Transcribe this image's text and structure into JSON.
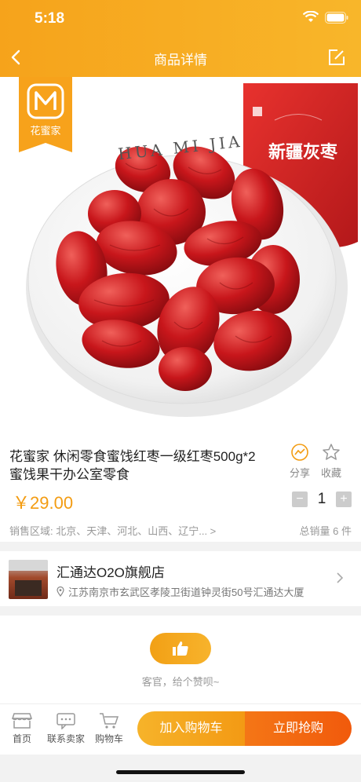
{
  "status_bar": {
    "time": "5:18"
  },
  "nav": {
    "title": "商品详情"
  },
  "hero": {
    "logo_text": "花蜜家",
    "plate_text": "HUA MI JIA",
    "bag_text": "新疆灰枣"
  },
  "product": {
    "title": "花蜜家 休闲零食蜜饯红枣一级红枣500g*2蜜饯果干办公室零食",
    "share_label": "分享",
    "fav_label": "收藏",
    "price": "￥29.00",
    "qty_minus": "−",
    "qty_value": "1",
    "qty_plus": "+",
    "region": "销售区域: 北京、天津、河北、山西、辽宁... >",
    "sold": "总销量 6 件"
  },
  "store": {
    "name": "汇通达O2O旗舰店",
    "address": "江苏南京市玄武区孝陵卫街道钟灵街50号汇通达大厦"
  },
  "like": {
    "text": "客官，给个赞呗~"
  },
  "bottom_bar": {
    "home_label": "首页",
    "contact_label": "联系卖家",
    "cart_label": "购物车",
    "add_cart_label": "加入购物车",
    "buy_label": "立即抢购"
  }
}
